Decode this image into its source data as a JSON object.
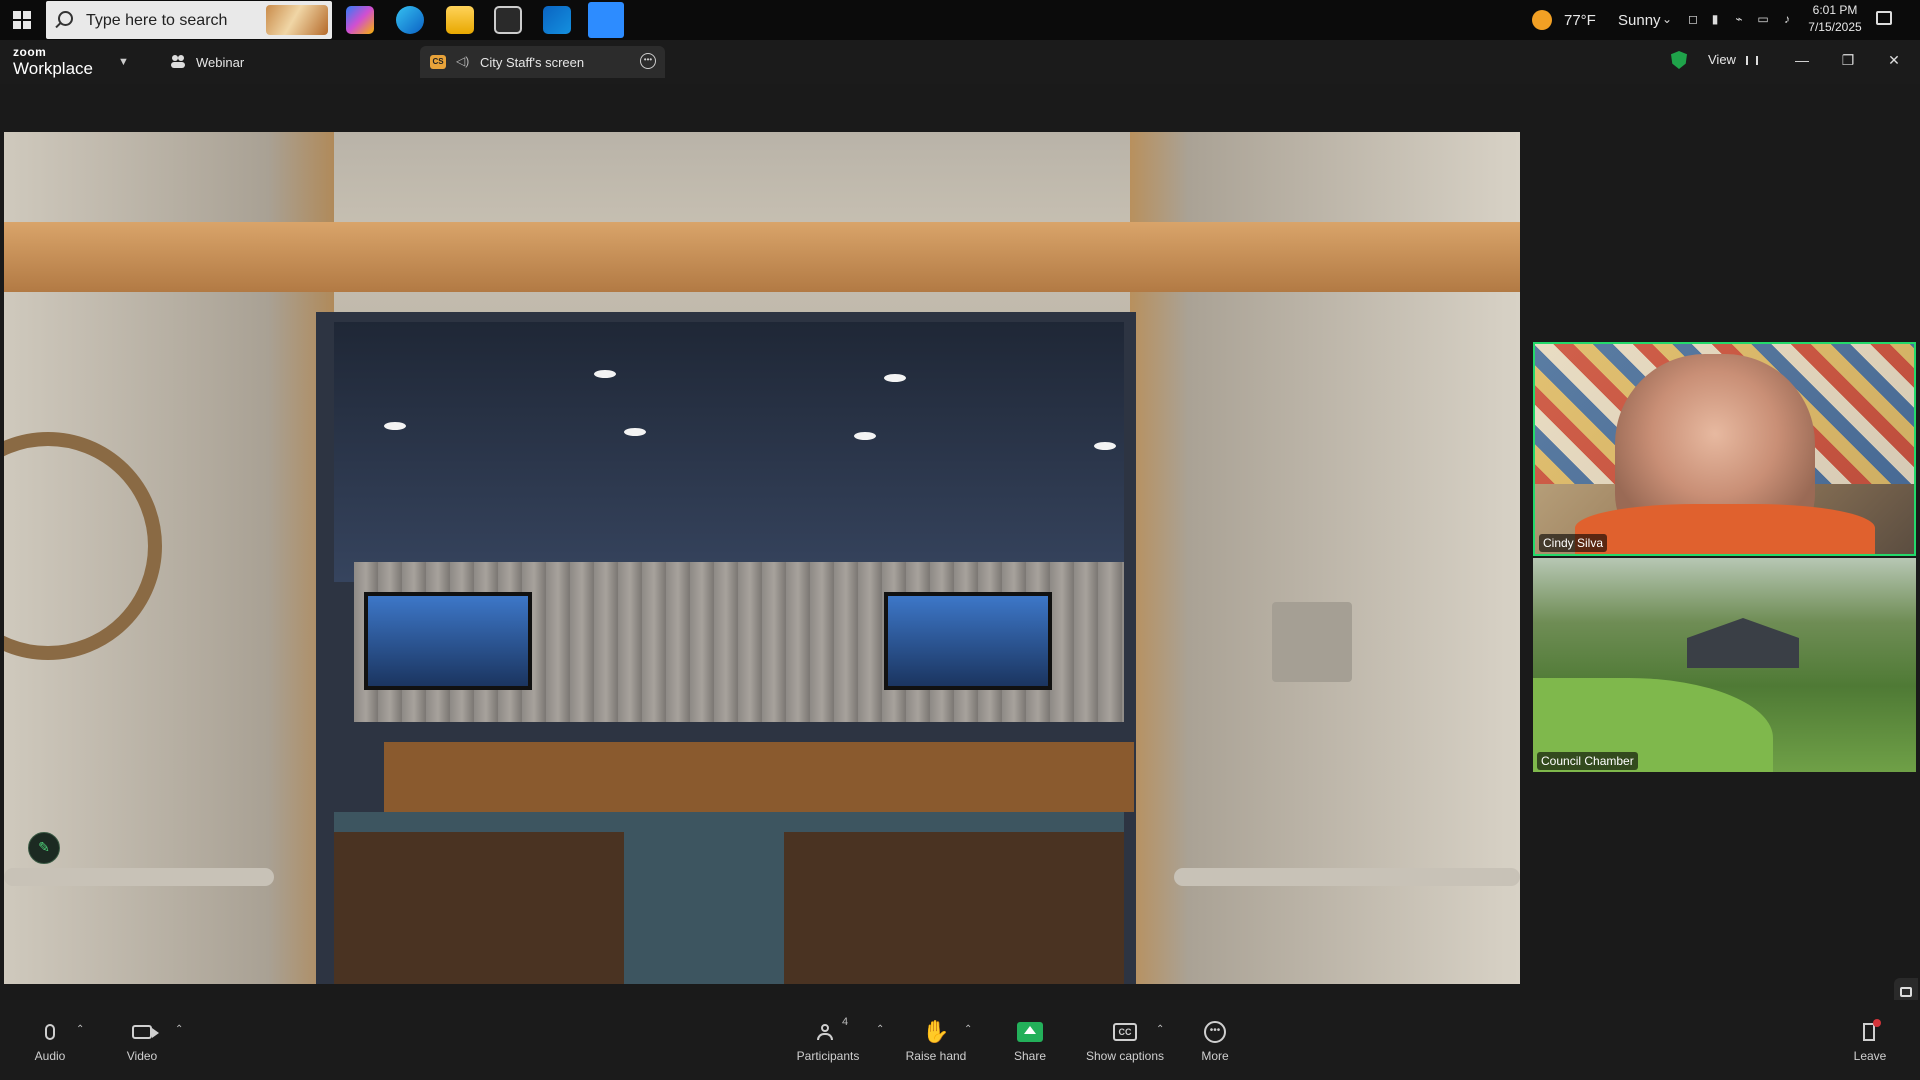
{
  "taskbar": {
    "search_placeholder": "Type here to search",
    "pinned_apps": [
      "copilot-icon",
      "edge-icon",
      "file-explorer-icon",
      "microsoft-store-icon",
      "outlook-icon",
      "zoom-icon"
    ],
    "weather": {
      "temperature": "77°F",
      "condition": "Sunny"
    },
    "clock": {
      "time": "6:01 PM",
      "date": "7/15/2025"
    }
  },
  "zoom": {
    "brand_top": "zoom",
    "brand_bottom": "Workplace",
    "webinar_label": "Webinar",
    "share_tab_badge": "CS",
    "share_tab_label": "City Staff's screen",
    "view_label": "View"
  },
  "gallery": {
    "tiles": [
      {
        "name": "Cindy Silva",
        "active_speaker": true
      },
      {
        "name": "Council Chamber",
        "active_speaker": false
      }
    ]
  },
  "controls": {
    "audio": "Audio",
    "video": "Video",
    "participants": "Participants",
    "participants_count": "4",
    "raise_hand": "Raise hand",
    "share": "Share",
    "captions": "Show captions",
    "captions_icon": "CC",
    "more": "More",
    "leave": "Leave"
  },
  "colors": {
    "active_speaker_border": "#23d96b",
    "share_green": "#23b05a",
    "security_shield": "#1fa34a",
    "leave_red": "#d4343a"
  }
}
